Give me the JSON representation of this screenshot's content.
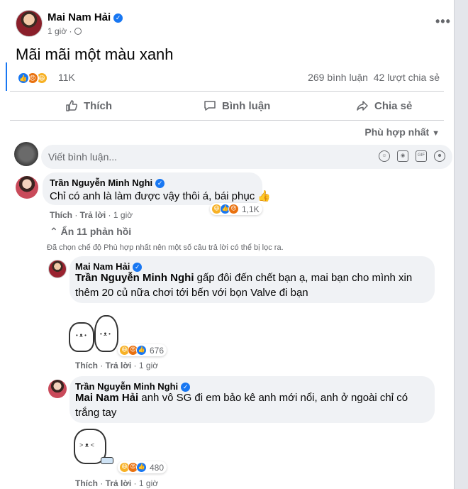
{
  "post": {
    "author": "Mai Nam Hải",
    "time": "1 giờ",
    "text": "Mãi mãi một màu xanh",
    "reaction_count": "11K",
    "comments_count": "269 bình luận",
    "shares_count": "42 lượt chia sẻ",
    "more_icon": "ellipsis-icon",
    "reaction_icons": [
      "like",
      "angry",
      "haha"
    ]
  },
  "actions": {
    "like": "Thích",
    "comment": "Bình luận",
    "share": "Chia sẻ"
  },
  "sort_label": "Phù hợp nhất",
  "comment_input": {
    "placeholder": "Viết bình luận..."
  },
  "comments": [
    {
      "author": "Trần Nguyễn Minh Nghi",
      "text": "Chỉ có anh là làm được vậy thôi á, bái phục 👍",
      "like_label": "Thích",
      "reply_label": "Trả lời",
      "time": "1 giờ",
      "reaction_count": "1,1K"
    }
  ],
  "hide_replies_label": "Ẩn 11 phản hồi",
  "filter_notice": "Đã chọn chế độ Phù hợp nhất nên một số câu trả lời có thể bị lọc ra.",
  "replies": [
    {
      "author": "Mai Nam Hải",
      "mention": "Trần Nguyễn Minh Nghi",
      "text": " gấp đôi đến chết bạn ạ, mai bạn cho mình xin thêm 20 củ nữa chơi tới bến với bọn Valve đi bạn",
      "like_label": "Thích",
      "reply_label": "Trả lời",
      "time": "1 giờ",
      "reaction_count": "676"
    },
    {
      "author": "Trần Nguyễn Minh Nghi",
      "mention": "Mai Nam Hải",
      "text": " anh vô SG đi em bảo kê anh mới nổi, anh ở ngoài chỉ có trắng tay",
      "like_label": "Thích",
      "reply_label": "Trả lời",
      "time": "1 giờ",
      "reaction_count": "480"
    }
  ],
  "colors": {
    "brand_blue": "#1877f2",
    "secondary_text": "#65676b",
    "bubble_bg": "#f0f2f5"
  }
}
